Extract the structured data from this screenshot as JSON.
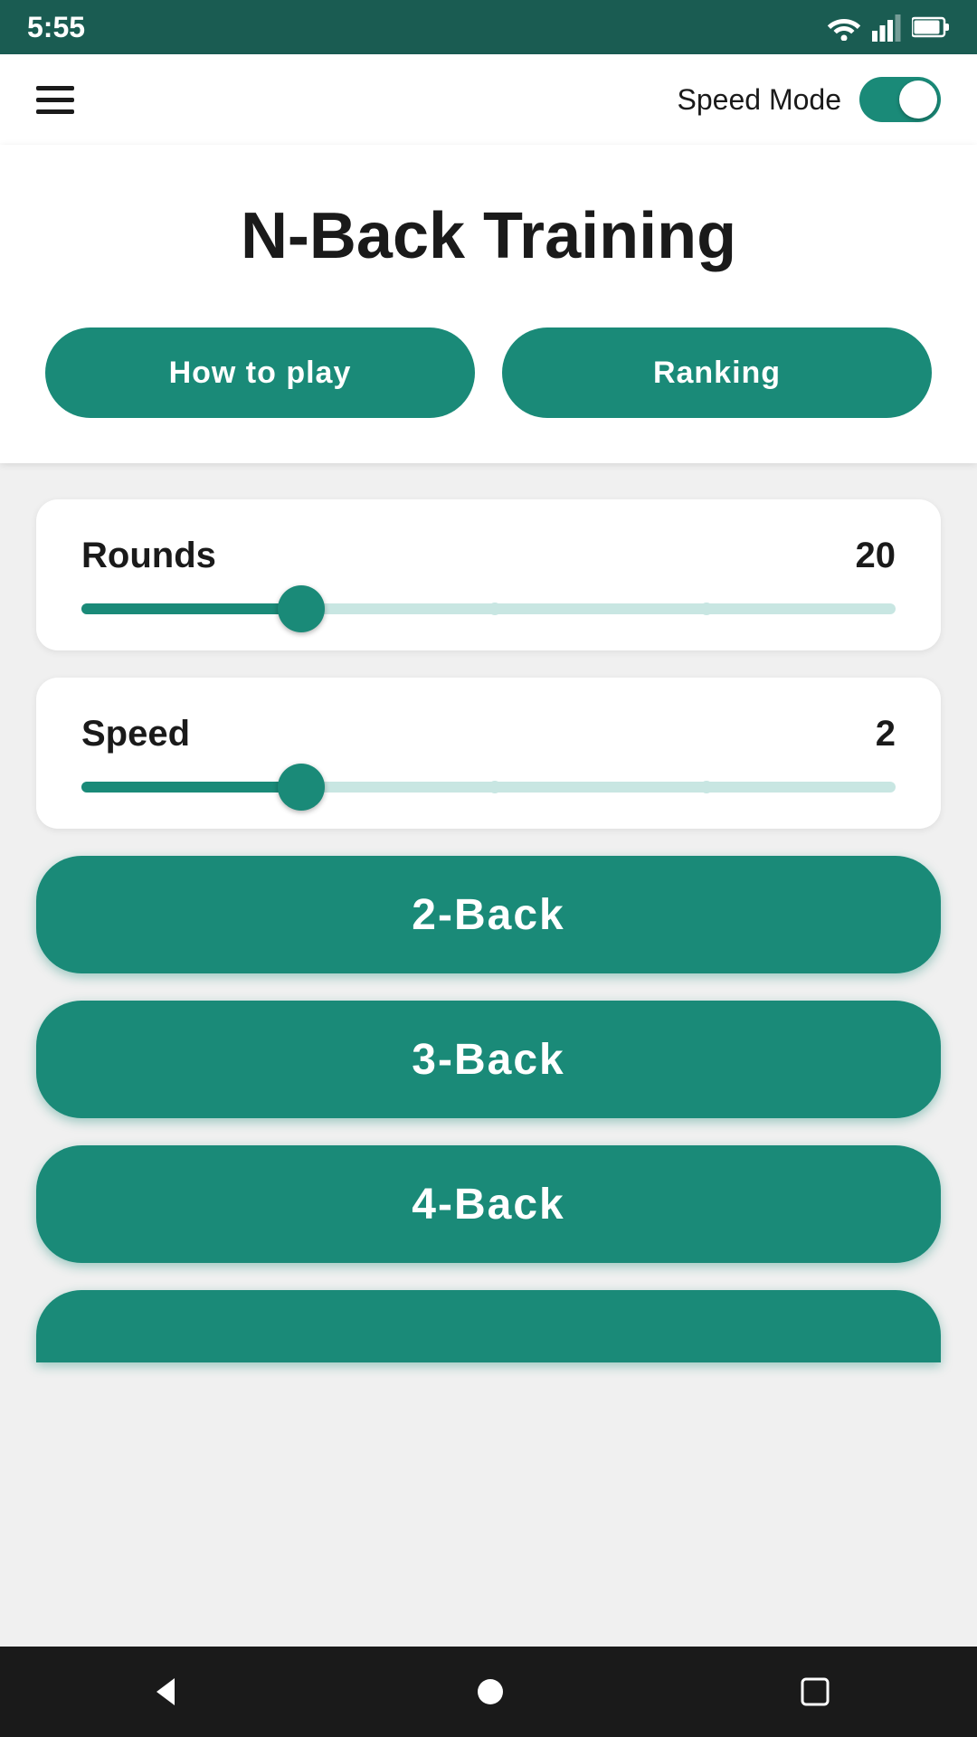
{
  "status_bar": {
    "time": "5:55"
  },
  "app_bar": {
    "speed_mode_label": "Speed Mode"
  },
  "hero": {
    "title": "N-Back Training",
    "how_to_play_label": "How to play",
    "ranking_label": "Ranking"
  },
  "rounds_slider": {
    "label": "Rounds",
    "value": "20",
    "fill_percent": 27
  },
  "speed_slider": {
    "label": "Speed",
    "value": "2",
    "fill_percent": 27
  },
  "game_buttons": [
    {
      "label": "2-Back"
    },
    {
      "label": "3-Back"
    },
    {
      "label": "4-Back"
    }
  ],
  "colors": {
    "teal": "#1a8a78",
    "dark_teal": "#1a5c52",
    "track": "#c8e6e2"
  }
}
